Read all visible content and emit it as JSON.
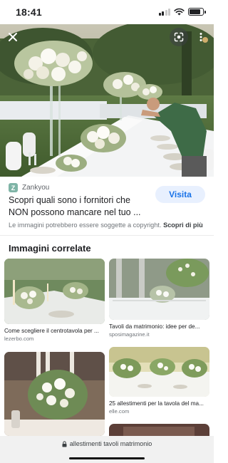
{
  "status_bar": {
    "time": "18:41",
    "battery_level": 0.85,
    "signal_bars_active": 2,
    "icons": [
      "signal-icon",
      "wifi-icon",
      "battery-icon"
    ]
  },
  "viewer": {
    "close_icon": "close-icon",
    "lens_icon": "google-lens-icon",
    "more_icon": "more-vert-icon"
  },
  "result": {
    "source_initial": "Z",
    "source_name": "Zankyou",
    "title": "Scopri quali sono i fornitori che NON possono mancare nel tuo ...",
    "visit_label": "Visita",
    "copyright_text": "Le immagini potrebbero essere soggette a copyright.",
    "learn_more_label": "Scopri di più"
  },
  "related": {
    "heading": "Immagini correlate",
    "items": [
      {
        "title": "Come scegliere il centrotavola per ...",
        "source": "lezerbo.com"
      },
      {
        "title": "Tavoli da matrimonio: idee per de...",
        "source": "sposimagazine.it"
      },
      {
        "title": "",
        "source": ""
      },
      {
        "title": "25 allestimenti per la tavola del ma...",
        "source": "elle.com"
      },
      {
        "title": "",
        "source": ""
      }
    ]
  },
  "url_bar": {
    "lock_icon": "lock-icon",
    "url": "allestimenti tavoli matrimonio"
  },
  "colors": {
    "accent": "#1a73e8",
    "visit_button_bg": "#e8f0fe",
    "url_bar_bg": "#f1f1f1"
  }
}
